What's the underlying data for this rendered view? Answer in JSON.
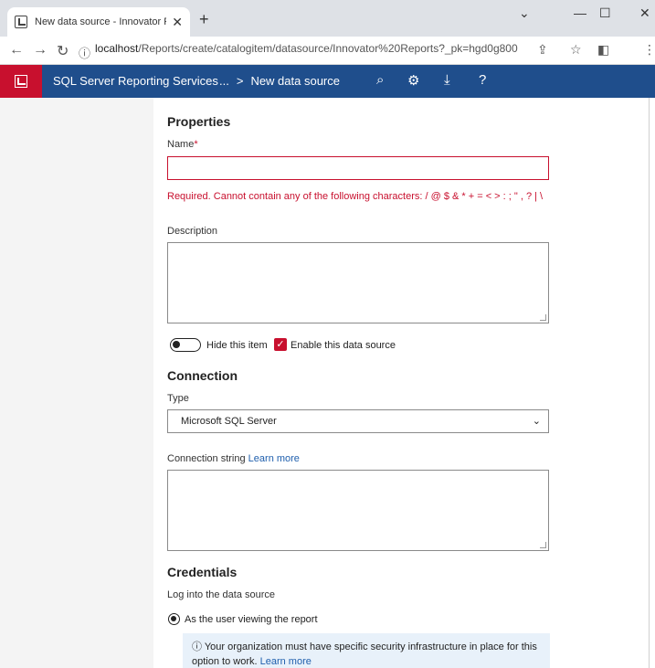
{
  "browser": {
    "tab_title": "New data source - Innovator Rep",
    "tab_close": "✕",
    "new_tab": "+",
    "url_host": "localhost",
    "url_path": "/Reports/create/catalogitem/datasource/Innovator%20Reports?_pk=hgd0g800"
  },
  "header": {
    "app_title": "SQL Server Reporting Services",
    "breadcrumb_ellipsis": "...",
    "breadcrumb_current": "New data source",
    "background_color": "#1f4e8c",
    "logo_color": "#c8102e"
  },
  "properties": {
    "heading": "Properties",
    "name_label": "Name",
    "name_required_mark": "*",
    "name_value": "",
    "name_error": "Required. Cannot contain any of the following characters: / @ $ & * + = < > : ; \" , ? | \\",
    "description_label": "Description",
    "description_value": "",
    "hide_item_label": "Hide this item",
    "hide_item_on": false,
    "enable_label": "Enable this data source",
    "enable_checked": true
  },
  "connection": {
    "heading": "Connection",
    "type_label": "Type",
    "type_value": "Microsoft SQL Server",
    "conn_string_label": "Connection string",
    "conn_string_link": "Learn more",
    "conn_string_value": ""
  },
  "credentials": {
    "heading": "Credentials",
    "login_label": "Log into the data source",
    "option_viewer": "As the user viewing the report",
    "info_icon": "ⓘ",
    "info_text": "Your organization must have specific security infrastructure in place for this option to work.",
    "info_link": "Learn more"
  }
}
